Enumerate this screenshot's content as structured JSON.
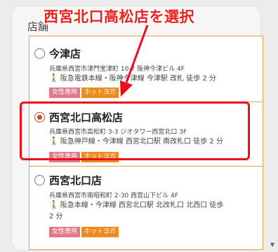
{
  "section_label": "店舗",
  "annotation": "西宮北口高松店を選択",
  "stores": [
    {
      "name": "今津店",
      "address": "兵庫県西宮市津門宝津町 10-7 阪神今津ビル 4F",
      "access": "阪急電鉄本線・阪神今津線 今津駅 改札 徒歩 2 分",
      "tags": [
        "女性専用",
        "ホットヨガ"
      ],
      "selected": false
    },
    {
      "name": "西宮北口高松店",
      "address": "兵庫県西宮市高松町 3-3 ジオタワー西宮北口 3F",
      "access": "阪急神戸線・今津線 西宮北口駅 南改札口 徒歩 2 分",
      "tags": [
        "女性専用",
        "ホットヨガ"
      ],
      "selected": true
    },
    {
      "name": "西宮北口店",
      "address": "兵庫県西宮市南昭和町 2-30 西宮山下ビル 4F",
      "access": "阪急本線・今津線 西宮北口駅 北改札口 北西口 徒歩 2 分",
      "tags": [
        "女性専用",
        "ホットヨガ"
      ],
      "selected": false
    }
  ],
  "colors": {
    "highlight": "#e8101b",
    "accent": "#e2a64a",
    "tag_women": "#e07a8a",
    "tag_hotyoga": "#ef8a22"
  },
  "icons": {
    "walk": "walking-person-icon",
    "scroll": "scroll-down-arrow-icon"
  }
}
